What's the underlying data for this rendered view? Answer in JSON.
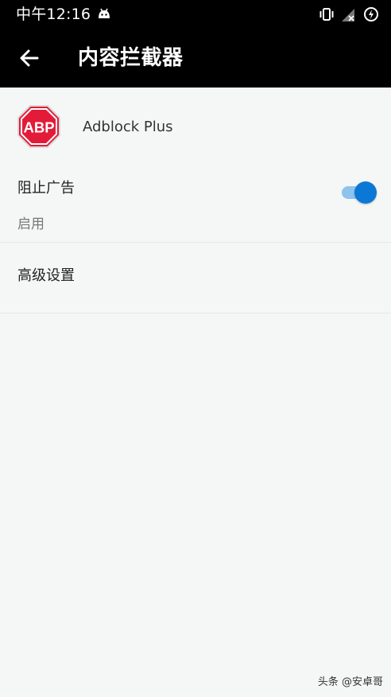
{
  "status_bar": {
    "time": "中午12:16",
    "left_icon": "android-robot-icon",
    "right_icons": [
      "vibrate-icon",
      "no-signal-icon",
      "battery-charging-icon"
    ]
  },
  "app_bar": {
    "back_icon": "back-arrow-icon",
    "title": "内容拦截器"
  },
  "content_blocker": {
    "logo_text": "ABP",
    "name": "Adblock Plus",
    "brand_color": "#e31b39"
  },
  "block_ads": {
    "label": "阻止广告",
    "status": "启用",
    "enabled": true,
    "accent_color": "#0b78d6"
  },
  "advanced_settings": {
    "label": "高级设置"
  },
  "watermark": "头条 @安卓哥"
}
